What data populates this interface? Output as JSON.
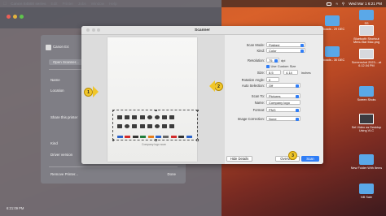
{
  "menubar": {
    "app_name": "Canon E4500 series",
    "items": [
      "Edit",
      "Printer",
      "Jobs",
      "Window",
      "Help"
    ],
    "datetime": "Wed Mar 1  6:21 PM"
  },
  "desktop": {
    "icons": [
      {
        "label": "SS",
        "thumb": "folder"
      },
      {
        "label": "Bluetooth Shortcut Menu Bar Mac.png",
        "thumb": "shot"
      },
      {
        "label": "Uploads - 29 DEC",
        "thumb": "folder"
      },
      {
        "label": "Uploads - 30 DEC",
        "thumb": "folder"
      },
      {
        "label": "Screenshot 2023-...at 6.12.04 PM",
        "thumb": "shot"
      },
      {
        "label": "Screen Shots",
        "thumb": "folder"
      },
      {
        "label": "Set Video as Desktop Using VLC",
        "thumb": "dark"
      },
      {
        "label": "New Folder With Items",
        "thumb": "folder"
      },
      {
        "label": "NB Sale",
        "thumb": "folder"
      }
    ]
  },
  "printer_window": {
    "title": "Canon E4500 series",
    "printer_name": "Canon E4",
    "open_scanner": "Open Scanner...",
    "rows": [
      "Name",
      "Location",
      "Share this printer",
      "Kind",
      "Driver version"
    ],
    "remove": "Remove Printer...",
    "done": "Done",
    "time": "6:21:09 PM"
  },
  "scanner": {
    "title": "Scanner",
    "preview_caption": "Company logo scan",
    "fields": {
      "scan_mode_label": "Scan Mode:",
      "scan_mode": "Flatbed",
      "kind_label": "Kind:",
      "kind": "Color",
      "resolution_label": "Resolution:",
      "resolution": "75",
      "resolution_unit": "dpi",
      "custom_size_label": "Use Custom Size",
      "size_label": "Size:",
      "size_w": "8.5",
      "size_h": "4.14",
      "size_unit": "inches",
      "rotation_label": "Rotation Angle:",
      "rotation": "0",
      "auto_selection_label": "Auto Selection:",
      "auto_selection": "Off",
      "scan_to_label": "Scan To:",
      "scan_to": "Pictures",
      "name_label": "Name:",
      "name": "Company logo",
      "format_label": "Format:",
      "format": "PNG",
      "correction_label": "Image Correction:",
      "correction": "None"
    },
    "buttons": {
      "hide_details": "Hide Details",
      "overview": "Overview",
      "scan": "Scan"
    }
  },
  "callouts": [
    "1",
    "2",
    "3"
  ],
  "colors": {
    "accent": "#2f7df6",
    "callout": "#f0c62a"
  }
}
